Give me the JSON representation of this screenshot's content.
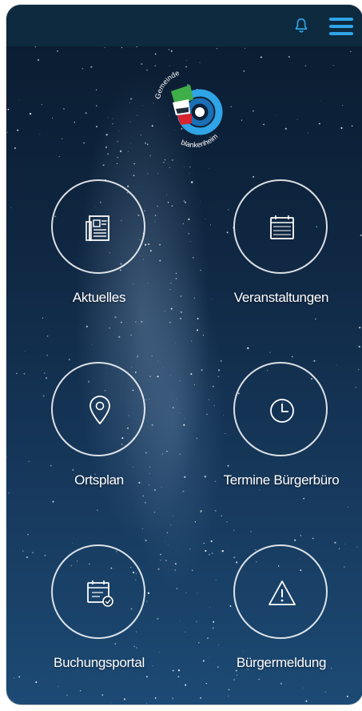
{
  "header": {
    "bell_icon": "bell-icon",
    "menu_icon": "hamburger-menu-icon",
    "accent_color": "#2fa4e6",
    "bar_color": "#0d2a3e"
  },
  "logo": {
    "text_top": "Gemeinde",
    "text_bottom": "blankenheim",
    "colors": [
      "#2fa4e6",
      "#1b6fb4",
      "#3fae49",
      "#d9232e"
    ]
  },
  "tiles": [
    {
      "label": "Aktuelles",
      "icon": "newspaper-icon"
    },
    {
      "label": "Veranstaltungen",
      "icon": "calendar-icon"
    },
    {
      "label": "Ortsplan",
      "icon": "map-pin-icon"
    },
    {
      "label": "Termine Bürgerbüro",
      "icon": "clock-icon"
    },
    {
      "label": "Buchungsportal",
      "icon": "booking-calendar-icon"
    },
    {
      "label": "Bürgermeldung",
      "icon": "warning-triangle-icon"
    }
  ],
  "background": "starry-night-sky"
}
